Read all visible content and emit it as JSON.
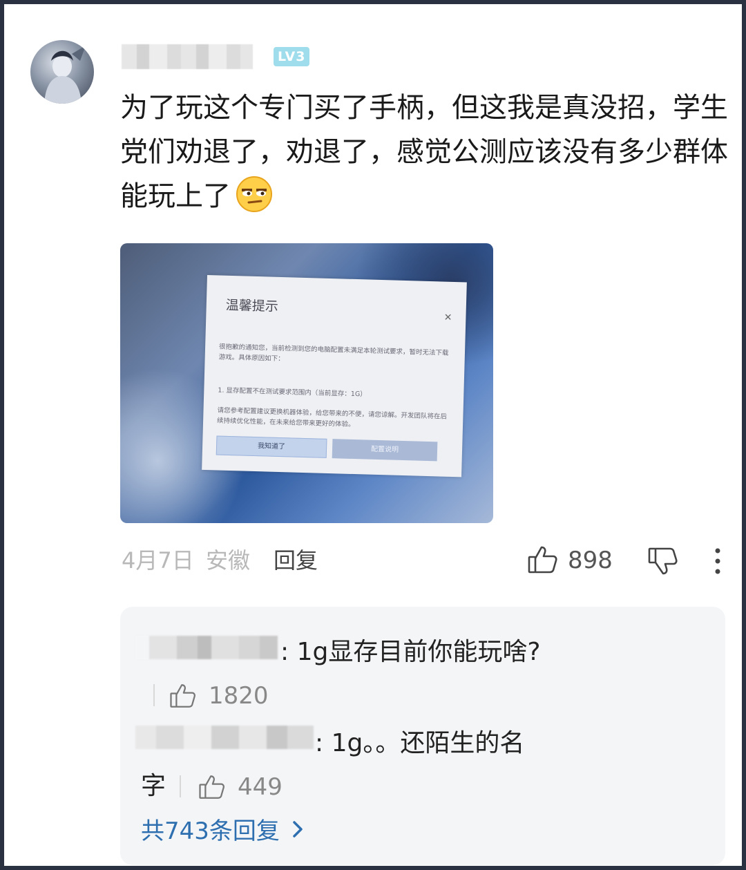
{
  "comment": {
    "level_badge": "LV3",
    "text": "为了玩这个专门买了手柄，但这我是真没招，学生党们劝退了，劝退了，感觉公测应该没有多少群体能玩上了",
    "emoji_icon": "smirk-face-icon",
    "image": {
      "dialog_title": "温馨提示",
      "dialog_body": "很抱歉的通知您，当前检测到您的电脑配置未满足本轮测试要求，暂时无法下载游戏。具体原因如下：",
      "dialog_item": "1. 显存配置不在测试要求范围内（当前显存：1G）",
      "dialog_note": "请您参考配置建议更换机器体验，给您带来的不便，请您谅解。开发团队将在后续持续优化性能，在未来给您带来更好的体验。",
      "button_ok": "我知道了",
      "button_config": "配置说明"
    },
    "date": "4月7日",
    "location": "安徽",
    "reply_label": "回复",
    "like_count": "898"
  },
  "replies": {
    "items": [
      {
        "text": ": 1g显存目前你能玩啥?",
        "like_count": "1820"
      },
      {
        "text": ": 1g。。还陌生的名",
        "text_cont": "字",
        "like_count": "449"
      }
    ],
    "more_label": "共743条回复"
  },
  "colors": {
    "link_blue": "#2e6fb0",
    "badge_cyan": "#9fdcec"
  }
}
